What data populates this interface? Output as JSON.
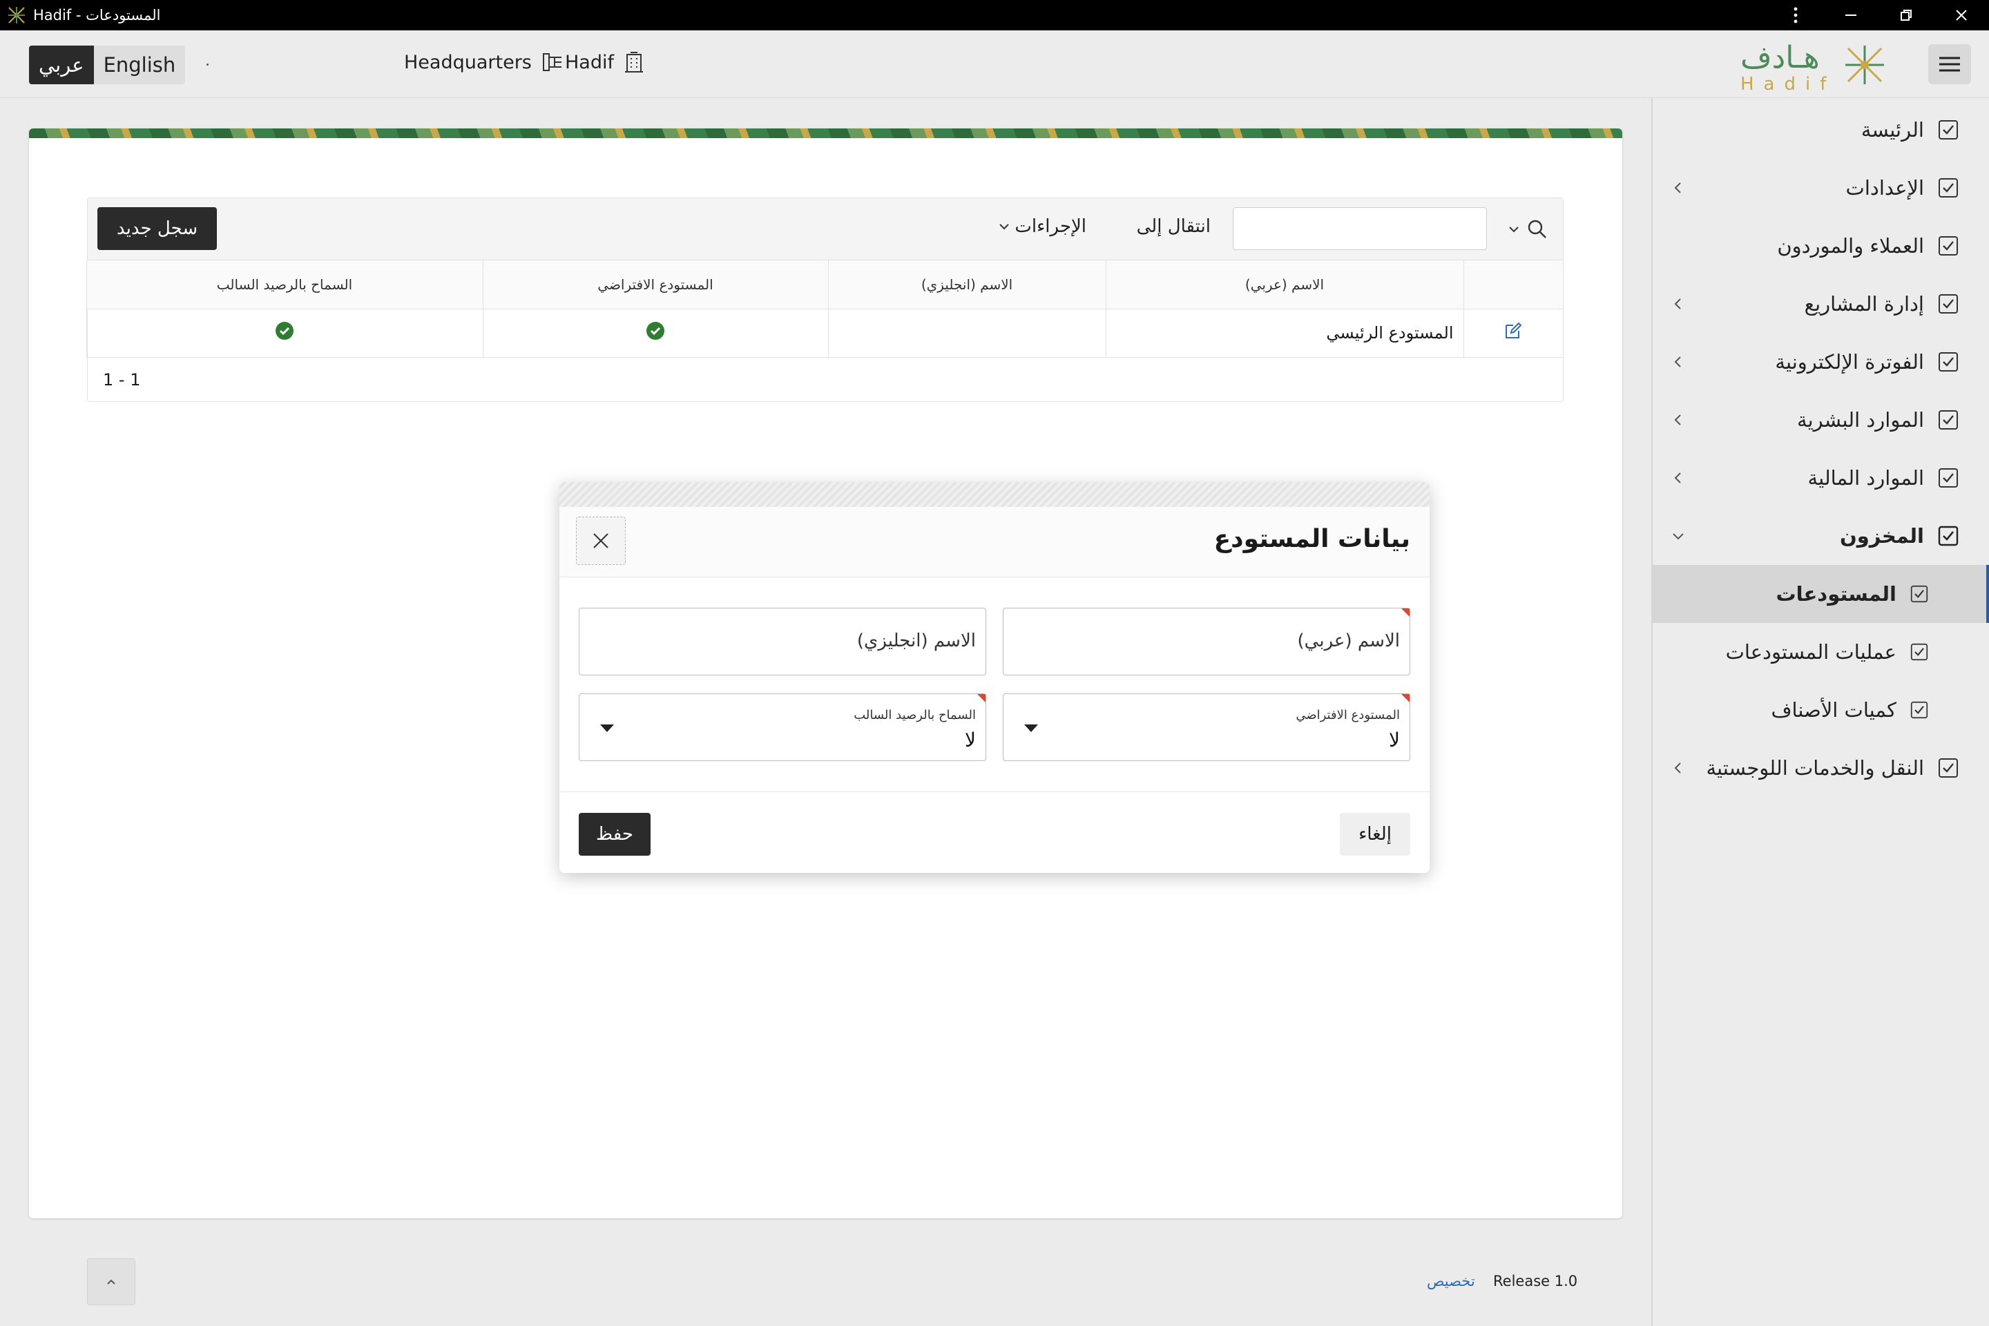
{
  "window": {
    "title": "Hadif - المستودعات"
  },
  "header": {
    "lang_active": "عربي",
    "lang_inactive": "English",
    "branch": "Headquarters",
    "organization": "Hadif",
    "logo_ar": "هـادف",
    "logo_en": "Hadif"
  },
  "sidebar": {
    "items": [
      {
        "label": "الرئيسة"
      },
      {
        "label": "الإعدادات"
      },
      {
        "label": "العملاء والموردون"
      },
      {
        "label": "إدارة المشاريع"
      },
      {
        "label": "الفوترة الإلكترونية"
      },
      {
        "label": "الموارد البشرية"
      },
      {
        "label": "الموارد المالية"
      },
      {
        "label": "المخزون"
      },
      {
        "label": "المستودعات"
      },
      {
        "label": "عمليات المستودعات"
      },
      {
        "label": "كميات الأصناف"
      },
      {
        "label": "النقل والخدمات اللوجستية"
      }
    ]
  },
  "report": {
    "goto_label": "انتقال إلى",
    "actions_label": "الإجراءات",
    "new_label": "سجل جديد",
    "columns": [
      "الاسم (عربي)",
      "الاسم (انجليزي)",
      "المستودع الافتراضي",
      "السماح بالرصيد السالب"
    ],
    "rows": [
      {
        "name_ar": "المستودع الرئيسي",
        "name_en": ""
      }
    ],
    "pagination": "1 - 1"
  },
  "footer": {
    "release": "Release 1.0",
    "customize": "تخصيص"
  },
  "modal": {
    "title": "بيانات المستودع",
    "name_ar_placeholder": "الاسم (عربي)",
    "name_en_placeholder": "الاسم (انجليزي)",
    "default_label": "المستودع الافتراضي",
    "default_value": "لا",
    "negative_label": "السماح بالرصيد السالب",
    "negative_value": "لا",
    "cancel_label": "إلغاء",
    "save_label": "حفظ"
  },
  "colors": {
    "accent": "#2b2b2b",
    "success": "#2e7d32",
    "link": "#2d6bb3",
    "required": "#e0462b"
  }
}
